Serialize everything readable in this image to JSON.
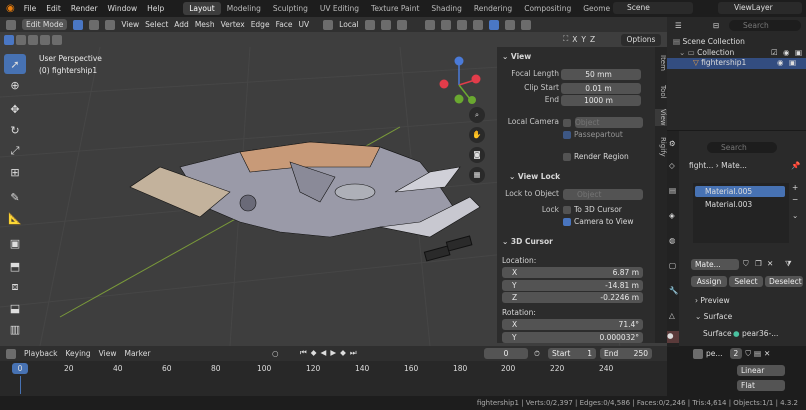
{
  "menu": [
    "File",
    "Edit",
    "Render",
    "Window",
    "Help"
  ],
  "workspaces": [
    {
      "label": "Layout",
      "active": true
    },
    {
      "label": "Modeling"
    },
    {
      "label": "Sculpting"
    },
    {
      "label": "UV Editing"
    },
    {
      "label": "Texture Paint"
    },
    {
      "label": "Shading"
    },
    {
      "label": "Rendering"
    },
    {
      "label": "Compositing"
    },
    {
      "label": "Geome"
    }
  ],
  "scene": "Scene",
  "view_layer": "ViewLayer",
  "viewport": {
    "mode": "Edit Mode",
    "menus": [
      "View",
      "Select",
      "Add",
      "Mesh",
      "Vertex",
      "Edge",
      "Face",
      "UV"
    ],
    "transform_orientation": "Local",
    "axes": [
      "X",
      "Y",
      "Z"
    ],
    "options_label": "Options",
    "perspective": "User Perspective",
    "object": "(0) fightership1"
  },
  "npanel": {
    "view_title": "View",
    "focal_length_label": "Focal Length",
    "focal_length": "50 mm",
    "clip_start_label": "Clip Start",
    "clip_start": "0.01 m",
    "end_label": "End",
    "clip_end": "1000 m",
    "local_camera_label": "Local Camera",
    "local_camera_placeholder": "Object",
    "passepartout": "Passepartout",
    "render_region": "Render Region",
    "view_lock_title": "View Lock",
    "lock_object_label": "Lock to Object",
    "lock_object_placeholder": "Object",
    "lock_label": "Lock",
    "lock_cursor": "To 3D Cursor",
    "camera_to_view": "Camera to View",
    "cursor_title": "3D Cursor",
    "location_label": "Location:",
    "loc_x_label": "X",
    "loc_x": "6.87 m",
    "loc_y_label": "Y",
    "loc_y": "-14.81 m",
    "loc_z_label": "Z",
    "loc_z": "-0.2246 m",
    "rotation_label": "Rotation:",
    "rot_x_label": "X",
    "rot_x": "71.4°",
    "rot_y_label": "Y",
    "rot_y": "0.000032°"
  },
  "sidetabs": [
    "Item",
    "Tool",
    "View",
    "Rigify"
  ],
  "outliner": {
    "search_placeholder": "Search",
    "scene_collection": "Scene Collection",
    "collection": "Collection",
    "object": "fightership1"
  },
  "props": {
    "search_placeholder": "Search",
    "breadcrumb_object": "fight...",
    "breadcrumb_material": "Mate...",
    "materials": [
      "Material.005",
      "Material.003"
    ],
    "material_name": "Mate...",
    "assign": "Assign",
    "select": "Select",
    "deselect": "Deselect",
    "preview": "Preview",
    "surface_section": "Surface",
    "surface_label": "Surface",
    "surface_value": "pear36-...",
    "node_short": "pe...",
    "users": "2",
    "interp": "Linear",
    "proj": "Flat"
  },
  "timeline": {
    "menus": [
      "Playback",
      "Keying",
      "View",
      "Marker"
    ],
    "current_frame": "0",
    "start_label": "Start",
    "start": "1",
    "end_label": "End",
    "end": "250",
    "ticks": [
      "0",
      "20",
      "40",
      "60",
      "80",
      "100",
      "120",
      "140",
      "160",
      "180",
      "200",
      "220",
      "240"
    ]
  },
  "status": "fightership1 | Verts:0/2,397 | Edges:0/4,586 | Faces:0/2,246 | Tris:4,614 | Objects:1/1 | 4.3.2"
}
